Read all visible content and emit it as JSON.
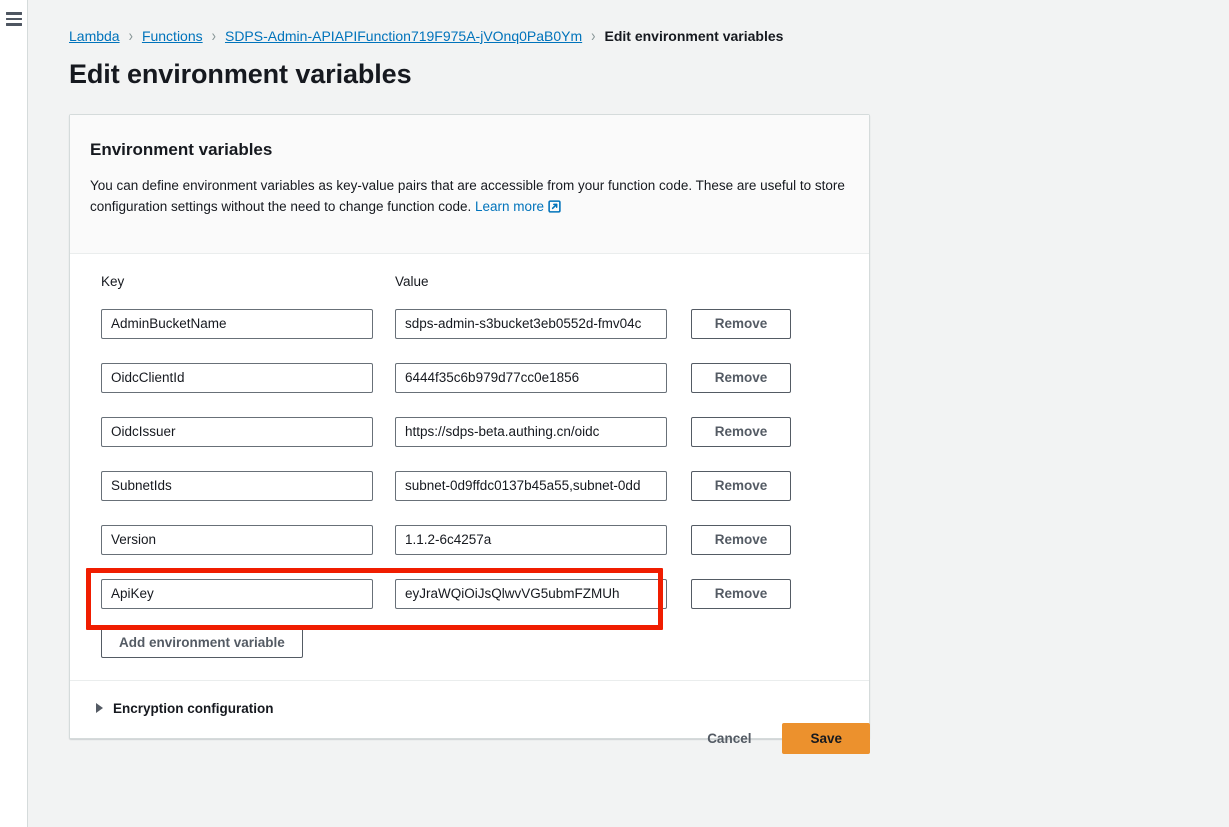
{
  "nav": {
    "menu_icon": "hamburger-menu-icon"
  },
  "breadcrumb": {
    "items": [
      {
        "label": "Lambda",
        "type": "link"
      },
      {
        "label": "Functions",
        "type": "link"
      },
      {
        "label": "SDPS-Admin-APIAPIFunction719F975A-jVOnq0PaB0Ym",
        "type": "link"
      },
      {
        "label": "Edit environment variables",
        "type": "current"
      }
    ],
    "separator": "›"
  },
  "page": {
    "title": "Edit environment variables"
  },
  "card": {
    "heading": "Environment variables",
    "description_part1": "You can define environment variables as key-value pairs that are accessible from your function code. These are useful to store configuration settings without the need to change function code.",
    "learn_more_label": "Learn more",
    "learn_more_icon": "external-link-icon"
  },
  "table": {
    "col_key_label": "Key",
    "col_value_label": "Value",
    "remove_label": "Remove",
    "rows": [
      {
        "key": "AdminBucketName",
        "value": "sdps-admin-s3bucket3eb0552d-fmv04c",
        "highlighted": false
      },
      {
        "key": "OidcClientId",
        "value": "6444f35c6b979d77cc0e1856",
        "highlighted": false
      },
      {
        "key": "OidcIssuer",
        "value": "https://sdps-beta.authing.cn/oidc",
        "highlighted": false
      },
      {
        "key": "SubnetIds",
        "value": "subnet-0d9ffdc0137b45a55,subnet-0dd",
        "highlighted": false
      },
      {
        "key": "Version",
        "value": "1.1.2-6c4257a",
        "highlighted": false
      },
      {
        "key": "ApiKey",
        "value": "eyJraWQiOiJsQlwvVG5ubmFZMUh",
        "highlighted": true
      }
    ],
    "add_label": "Add environment variable"
  },
  "encryption": {
    "label": "Encryption configuration",
    "caret_icon": "caret-right-icon",
    "expanded": false
  },
  "footer": {
    "cancel_label": "Cancel",
    "save_label": "Save"
  },
  "colors": {
    "link": "#0073bb",
    "primary_button": "#ec912d",
    "highlight": "#f01d00",
    "page_background": "#f2f3f3",
    "card_header_background": "#fafafa",
    "border": "#d5dbdb",
    "text": "#16191f"
  }
}
